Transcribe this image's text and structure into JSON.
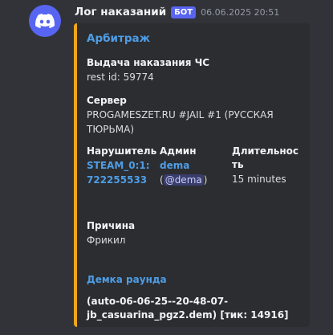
{
  "message": {
    "author": "Лог наказаний",
    "bot_tag": "БОТ",
    "timestamp": "06.06.2025 20:51"
  },
  "embed": {
    "accent_color": "#f0a61c",
    "title": "Арбитраж",
    "punishment": {
      "name": "Выдача наказания ЧС",
      "value": "rest id: 59774"
    },
    "server": {
      "name": "Сервер",
      "value_line1": "PROGAMESZET.RU #JAIL #1 (РУССКАЯ",
      "value_line2": "ТЮРЬМА)"
    },
    "violator": {
      "name": "Нарушитель",
      "value_line1": "STEAM_0:1:",
      "value_line2": "722255533"
    },
    "admin": {
      "name": "Админ",
      "value": "dema",
      "paren_open": "(",
      "mention": "@dema",
      "paren_close": ")"
    },
    "duration": {
      "name_line1": "Длительнос",
      "name_line2": "ть",
      "value": "15 minutes"
    },
    "reason": {
      "name": "Причина",
      "value": "Фрикил"
    },
    "demo": {
      "link_label": "Демка раунда",
      "file_line1": "(auto-06-06-25--20-48-07-",
      "file_line2": "jb_casuarina_pgz2.dem) [тик: 14916]"
    }
  }
}
